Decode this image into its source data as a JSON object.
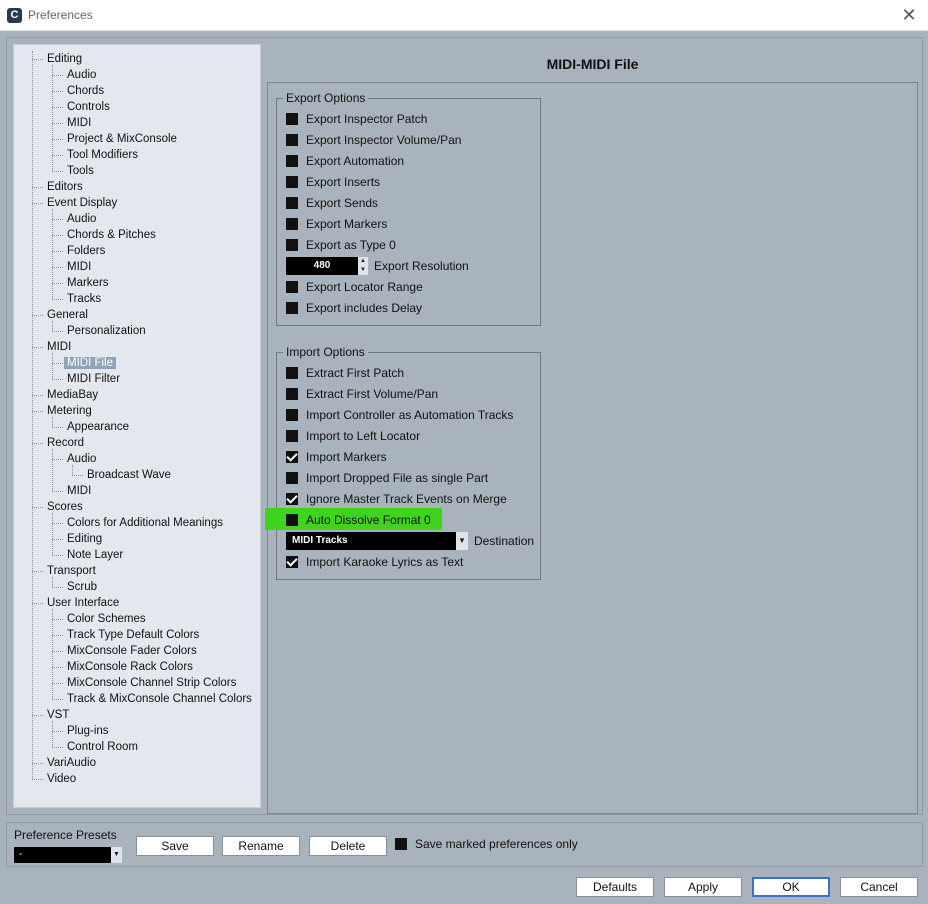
{
  "window": {
    "title": "Preferences",
    "close_glyph": "✕",
    "app_icon_glyph": "C"
  },
  "tree": {
    "items": [
      {
        "label": "Editing",
        "level": 0
      },
      {
        "label": "Audio",
        "level": 1
      },
      {
        "label": "Chords",
        "level": 1
      },
      {
        "label": "Controls",
        "level": 1
      },
      {
        "label": "MIDI",
        "level": 1
      },
      {
        "label": "Project & MixConsole",
        "level": 1
      },
      {
        "label": "Tool Modifiers",
        "level": 1
      },
      {
        "label": "Tools",
        "level": 1
      },
      {
        "label": "Editors",
        "level": 0
      },
      {
        "label": "Event Display",
        "level": 0
      },
      {
        "label": "Audio",
        "level": 1
      },
      {
        "label": "Chords & Pitches",
        "level": 1
      },
      {
        "label": "Folders",
        "level": 1
      },
      {
        "label": "MIDI",
        "level": 1
      },
      {
        "label": "Markers",
        "level": 1
      },
      {
        "label": "Tracks",
        "level": 1
      },
      {
        "label": "General",
        "level": 0
      },
      {
        "label": "Personalization",
        "level": 1
      },
      {
        "label": "MIDI",
        "level": 0
      },
      {
        "label": "MIDI File",
        "level": 1,
        "selected": true
      },
      {
        "label": "MIDI Filter",
        "level": 1
      },
      {
        "label": "MediaBay",
        "level": 0
      },
      {
        "label": "Metering",
        "level": 0
      },
      {
        "label": "Appearance",
        "level": 1
      },
      {
        "label": "Record",
        "level": 0
      },
      {
        "label": "Audio",
        "level": 1
      },
      {
        "label": "Broadcast Wave",
        "level": 2
      },
      {
        "label": "MIDI",
        "level": 1
      },
      {
        "label": "Scores",
        "level": 0
      },
      {
        "label": "Colors for Additional Meanings",
        "level": 1
      },
      {
        "label": "Editing",
        "level": 1
      },
      {
        "label": "Note Layer",
        "level": 1
      },
      {
        "label": "Transport",
        "level": 0
      },
      {
        "label": "Scrub",
        "level": 1
      },
      {
        "label": "User Interface",
        "level": 0
      },
      {
        "label": "Color Schemes",
        "level": 1
      },
      {
        "label": "Track Type Default Colors",
        "level": 1
      },
      {
        "label": "MixConsole Fader Colors",
        "level": 1
      },
      {
        "label": "MixConsole Rack Colors",
        "level": 1
      },
      {
        "label": "MixConsole Channel Strip Colors",
        "level": 1
      },
      {
        "label": "Track & MixConsole Channel Colors",
        "level": 1
      },
      {
        "label": "VST",
        "level": 0
      },
      {
        "label": "Plug-ins",
        "level": 1
      },
      {
        "label": "Control Room",
        "level": 1
      },
      {
        "label": "VariAudio",
        "level": 0
      },
      {
        "label": "Video",
        "level": 0
      }
    ]
  },
  "page": {
    "title": "MIDI-MIDI File"
  },
  "export_options": {
    "title": "Export Options",
    "items": [
      {
        "label": "Export Inspector Patch",
        "checked": false
      },
      {
        "label": "Export Inspector Volume/Pan",
        "checked": false
      },
      {
        "label": "Export Automation",
        "checked": false
      },
      {
        "label": "Export Inserts",
        "checked": false
      },
      {
        "label": "Export Sends",
        "checked": false
      },
      {
        "label": "Export Markers",
        "checked": false
      },
      {
        "label": "Export as Type 0",
        "checked": false
      }
    ],
    "resolution": {
      "value": "480",
      "label": "Export Resolution"
    },
    "items_after": [
      {
        "label": "Export Locator Range",
        "checked": false
      },
      {
        "label": "Export includes Delay",
        "checked": false
      }
    ]
  },
  "import_options": {
    "title": "Import Options",
    "items": [
      {
        "label": "Extract First Patch",
        "checked": false
      },
      {
        "label": "Extract First Volume/Pan",
        "checked": false
      },
      {
        "label": "Import Controller as Automation Tracks",
        "checked": false
      },
      {
        "label": "Import to Left Locator",
        "checked": false
      },
      {
        "label": "Import Markers",
        "checked": true
      },
      {
        "label": "Import Dropped File as single Part",
        "checked": false
      },
      {
        "label": "Ignore Master Track Events on Merge",
        "checked": true
      },
      {
        "label": "Auto Dissolve Format 0",
        "checked": false,
        "highlighted": true
      }
    ],
    "destination": {
      "value": "MIDI Tracks",
      "label": "Destination"
    },
    "items_after": [
      {
        "label": "Import Karaoke Lyrics as Text",
        "checked": true
      }
    ],
    "highlight_color": "#3fd21e"
  },
  "presets": {
    "label": "Preference Presets",
    "selected": "-",
    "save_label": "Save",
    "rename_label": "Rename",
    "delete_label": "Delete",
    "save_marked_label": "Save marked preferences only",
    "save_marked_checked": false
  },
  "footer": {
    "defaults_label": "Defaults",
    "apply_label": "Apply",
    "ok_label": "OK",
    "cancel_label": "Cancel"
  },
  "colors": {
    "background": "#a9b3bd",
    "tree_background": "#e3e8ee",
    "selection": "#8ea2b8",
    "default_button_border": "#3b73c6"
  }
}
